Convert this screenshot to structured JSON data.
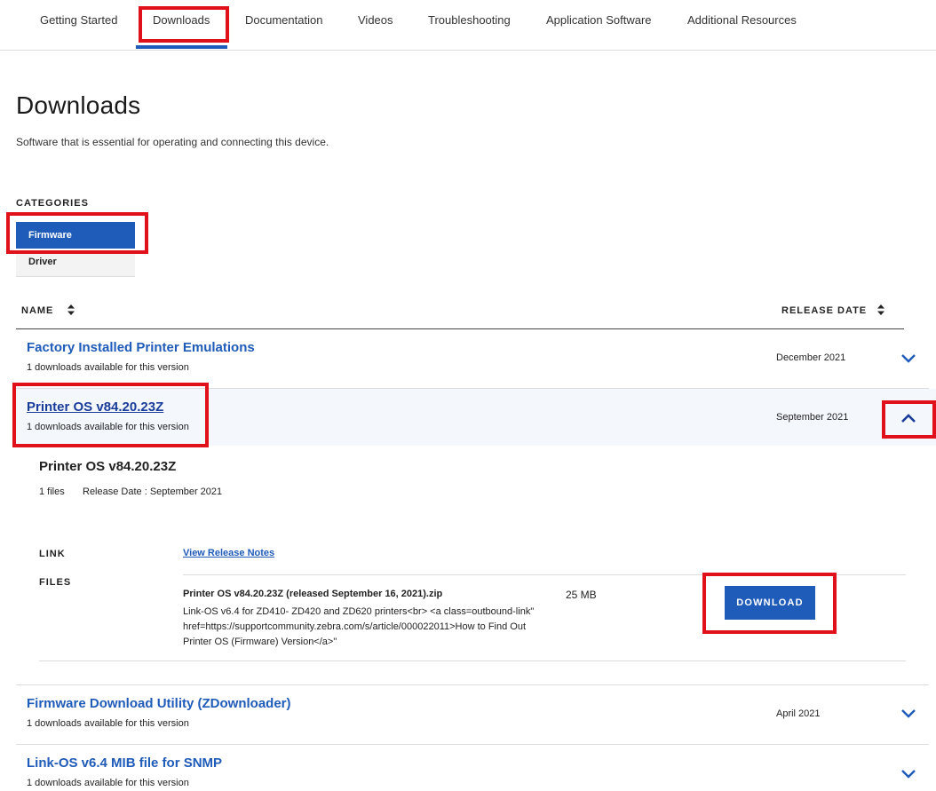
{
  "tabs": [
    "Getting Started",
    "Downloads",
    "Documentation",
    "Videos",
    "Troubleshooting",
    "Application Software",
    "Additional Resources"
  ],
  "active_tab": "Downloads",
  "page": {
    "title": "Downloads",
    "subtitle": "Software that is essential for operating and connecting this device."
  },
  "categories": {
    "label": "CATEGORIES",
    "items": [
      "Firmware",
      "Driver"
    ],
    "selected": "Firmware"
  },
  "table": {
    "col_name": "NAME",
    "col_date": "RELEASE DATE",
    "rows": [
      {
        "title": "Factory Installed Printer Emulations",
        "count": "1 downloads available for this version",
        "date": "December 2021",
        "expanded": false
      },
      {
        "title": "Printer OS v84.20.23Z",
        "count": "1 downloads available for this version",
        "date": "September 2021",
        "expanded": true
      },
      {
        "title": "Firmware Download Utility (ZDownloader)",
        "count": "1 downloads available for this version",
        "date": "April 2021",
        "expanded": false
      },
      {
        "title": "Link-OS v6.4 MIB file for SNMP",
        "count": "1 downloads available for this version",
        "date": "",
        "expanded": false
      }
    ]
  },
  "detail": {
    "title": "Printer OS v84.20.23Z",
    "files_count": "1 files",
    "release_date": "Release Date : September 2021",
    "link_label": "LINK",
    "link_text": "View Release Notes",
    "files_label": "FILES",
    "file_name": "Printer OS v84.20.23Z (released September 16, 2021).zip",
    "file_desc": "Link-OS v6.4 for ZD410- ZD420 and ZD620 printers<br> <a class=outbound-link\" href=https://supportcommunity.zebra.com/s/article/000022011>How to Find Out Printer OS (Firmware) Version</a>\"",
    "file_size": "25 MB",
    "download_label": "DOWNLOAD"
  },
  "colors": {
    "accent": "#1f5bb8",
    "highlight_box": "#e0111b"
  },
  "icons": {
    "sort": "sort-updown-icon",
    "expand": "chevron-down-icon",
    "collapse": "chevron-up-icon"
  }
}
